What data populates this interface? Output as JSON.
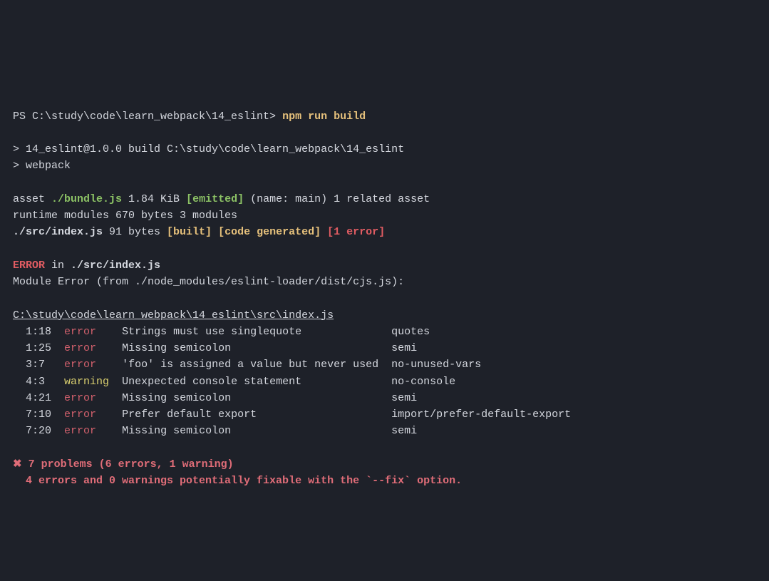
{
  "prompt": {
    "cwd": "PS C:\\study\\code\\learn_webpack\\14_eslint>",
    "command": "npm run build"
  },
  "npm_header": {
    "line1": "> 14_eslint@1.0.0 build C:\\study\\code\\learn_webpack\\14_eslint",
    "line2": "> webpack"
  },
  "asset": {
    "prefix": "asset ",
    "file": "./bundle.js",
    "size": " 1.84 KiB ",
    "emitted": "[emitted]",
    "suffix": " (name: main) 1 related asset"
  },
  "runtime_line": "runtime modules 670 bytes 3 modules",
  "source": {
    "file": "./src/index.js",
    "size": " 91 bytes ",
    "built": "[built]",
    "codegen": "[code generated]",
    "err": "[1 error]"
  },
  "error_header": {
    "error_word": "ERROR",
    "rest": " in ",
    "file": "./src/index.js"
  },
  "module_error_line": "Module Error (from ./node_modules/eslint-loader/dist/cjs.js):",
  "lint_file": "C:\\study\\code\\learn_webpack\\14_eslint\\src\\index.js",
  "lint_rows": [
    {
      "loc": "  1:18",
      "sev": "error",
      "msg": "Strings must use singlequote",
      "rule": "quotes"
    },
    {
      "loc": "  1:25",
      "sev": "error",
      "msg": "Missing semicolon",
      "rule": "semi"
    },
    {
      "loc": "  3:7 ",
      "sev": "error",
      "msg": "'foo' is assigned a value but never used",
      "rule": "no-unused-vars"
    },
    {
      "loc": "  4:3 ",
      "sev": "warning",
      "msg": "Unexpected console statement",
      "rule": "no-console"
    },
    {
      "loc": "  4:21",
      "sev": "error",
      "msg": "Missing semicolon",
      "rule": "semi"
    },
    {
      "loc": "  7:10",
      "sev": "error",
      "msg": "Prefer default export",
      "rule": "import/prefer-default-export"
    },
    {
      "loc": "  7:20",
      "sev": "error",
      "msg": "Missing semicolon",
      "rule": "semi"
    }
  ],
  "summary": {
    "cross": "✖",
    "headline": " 7 problems (6 errors, 1 warning)",
    "fixable": "  4 errors and 0 warnings potentially fixable with the `--fix` option."
  }
}
